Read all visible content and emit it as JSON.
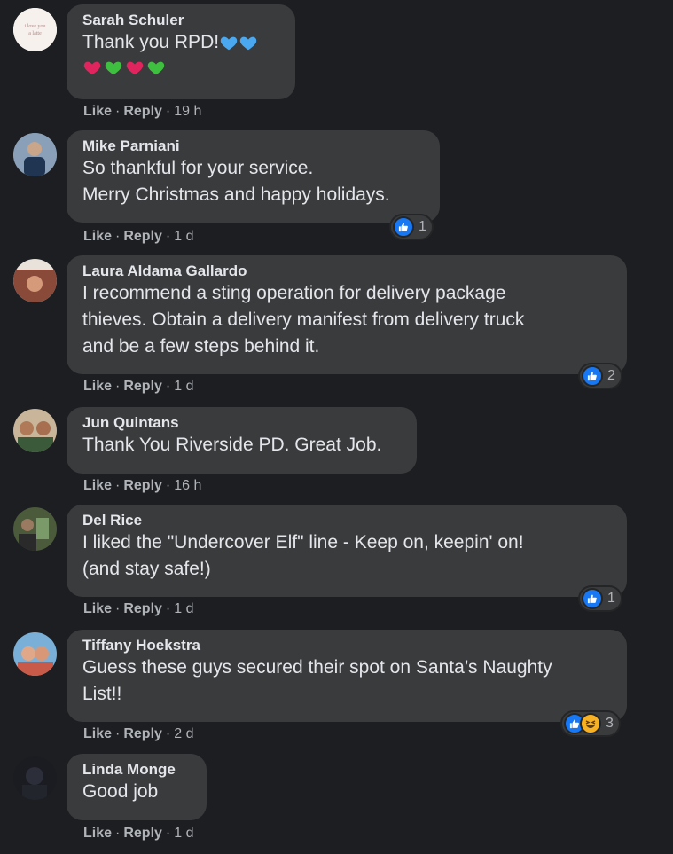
{
  "comments": [
    {
      "author": "Sarah Schuler",
      "text": "Thank you RPD!",
      "inline_emojis": [
        "blue-heart",
        "blue-heart"
      ],
      "emoji_line": [
        "red-heart",
        "green-heart",
        "red-heart",
        "green-heart"
      ],
      "like_label": "Like",
      "reply_label": "Reply",
      "time": "19 h"
    },
    {
      "author": "Mike Parniani",
      "text": "So thankful for your service.\nMerry Christmas and happy holidays.",
      "like_label": "Like",
      "reply_label": "Reply",
      "time": "1 d",
      "reaction_count": "1",
      "reactions": [
        "like-icon"
      ]
    },
    {
      "author": "Laura Aldama Gallardo",
      "text": "I recommend a sting operation for delivery package\nthieves. Obtain a delivery manifest from delivery truck\nand be a few steps behind it.",
      "like_label": "Like",
      "reply_label": "Reply",
      "time": "1 d",
      "reaction_count": "2",
      "reactions": [
        "like-icon"
      ]
    },
    {
      "author": "Jun Quintans",
      "text": "Thank You Riverside PD. Great Job.",
      "like_label": "Like",
      "reply_label": "Reply",
      "time": "16 h"
    },
    {
      "author": "Del Rice",
      "text": "I liked the \"Undercover Elf\" line - Keep on, keepin' on!\n(and stay safe!)",
      "like_label": "Like",
      "reply_label": "Reply",
      "time": "1 d",
      "reaction_count": "1",
      "reactions": [
        "like-icon"
      ]
    },
    {
      "author": "Tiffany Hoekstra",
      "text": "Guess these guys secured their spot on Santa’s Naughty\nList!!",
      "like_label": "Like",
      "reply_label": "Reply",
      "time": "2 d",
      "reaction_count": "3",
      "reactions": [
        "like-icon",
        "haha-icon"
      ]
    },
    {
      "author": "Linda Monge",
      "text": "Good job",
      "like_label": "Like",
      "reply_label": "Reply",
      "time": "1 d"
    }
  ],
  "colors": {
    "background": "#1c1e21",
    "bubble": "#3a3b3c",
    "text": "#e4e6eb",
    "secondary_text": "#b0b3b8",
    "like_blue": "#1877f2",
    "red_heart": "#e0245e",
    "green_heart": "#3fbf3f",
    "blue_heart": "#4aa8f0"
  }
}
